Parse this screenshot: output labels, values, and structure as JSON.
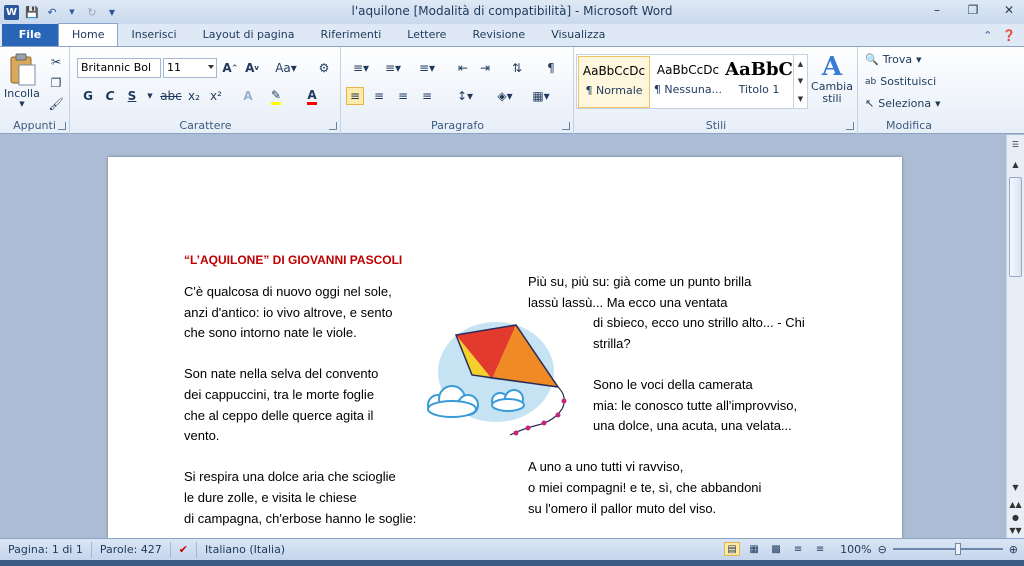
{
  "window": {
    "title": "l'aquilone [Modalità di compatibilità] - Microsoft Word",
    "app_icon": "W"
  },
  "tabs": [
    {
      "label": "File"
    },
    {
      "label": "Home"
    },
    {
      "label": "Inserisci"
    },
    {
      "label": "Layout di pagina"
    },
    {
      "label": "Riferimenti"
    },
    {
      "label": "Lettere"
    },
    {
      "label": "Revisione"
    },
    {
      "label": "Visualizza"
    }
  ],
  "ribbon": {
    "clipboard": {
      "paste_label": "Incolla",
      "group_label": "Appunti"
    },
    "font": {
      "name": "Britannic Bol",
      "size": "11",
      "group_label": "Carattere",
      "bold": "G",
      "italic": "C",
      "underline": "S",
      "strike": "abc",
      "sub": "x₂",
      "sup": "x²"
    },
    "paragraph": {
      "group_label": "Paragrafo"
    },
    "styles": {
      "group_label": "Stili",
      "items": [
        {
          "preview": "AaBbCcDc",
          "name": "¶ Normale"
        },
        {
          "preview": "AaBbCcDc",
          "name": "¶ Nessuna..."
        },
        {
          "preview": "AaBbC",
          "name": "Titolo 1"
        }
      ],
      "change_label": "Cambia stili"
    },
    "editing": {
      "group_label": "Modifica",
      "find": "Trova",
      "replace": "Sostituisci",
      "select": "Seleziona"
    }
  },
  "document": {
    "title": "“L’AQUILONE” DI GIOVANNI PASCOLI",
    "left_stanzas": [
      [
        "C'è qualcosa di nuovo oggi nel sole,",
        "anzi d'antico: io vivo altrove, e sento",
        "che sono intorno nate le viole."
      ],
      [
        "Son nate nella selva del convento",
        "dei cappuccini, tra le morte foglie",
        "che al ceppo delle querce agita il",
        "vento."
      ],
      [
        "Si respira una dolce aria che scioglie",
        "le dure zolle, e visita le chiese",
        "di campagna, ch'erbose hanno le soglie:"
      ]
    ],
    "right_stanzas": [
      {
        "lines": [
          "Più su, più su: già come un punto brilla",
          "lassù lassù... Ma ecco una ventata"
        ],
        "indent_lines": [
          "di sbieco, ecco uno strillo alto... - Chi",
          "strilla?"
        ]
      },
      {
        "lines": [],
        "indent_lines": [
          "Sono le voci della camerata",
          "mia: le conosco tutte all'improvviso,",
          "una dolce, una acuta, una velata..."
        ]
      },
      {
        "lines": [
          "A uno a uno tutti vi ravviso,",
          "o miei compagni! e te, sì, che abbandoni",
          "su l'omero il pallor muto del viso."
        ],
        "indent_lines": []
      }
    ]
  },
  "status": {
    "page": "Pagina: 1 di 1",
    "words": "Parole: 427",
    "language": "Italiano (Italia)",
    "zoom": "100%"
  }
}
